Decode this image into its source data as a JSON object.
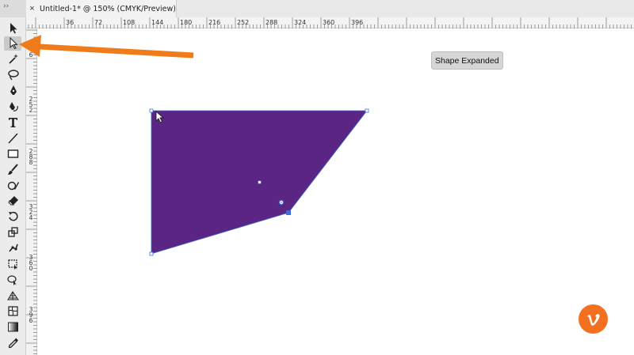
{
  "app": {
    "tab_title": "Untitled-1* @ 150% (CMYK/Preview)",
    "tab_close_glyph": "×",
    "panel_grip_glyph": "››"
  },
  "ruler_top": {
    "labels": [
      "36",
      "72",
      "108",
      "144",
      "180",
      "216",
      "252",
      "288",
      "324",
      "360",
      "396"
    ]
  },
  "ruler_left": {
    "labels": [
      "6",
      "252",
      "288",
      "324",
      "360",
      "396"
    ]
  },
  "tools": [
    {
      "name": "selection-tool-icon",
      "active": false
    },
    {
      "name": "direct-selection-tool-icon",
      "active": true
    },
    {
      "name": "magic-wand-tool-icon",
      "active": false
    },
    {
      "name": "lasso-tool-icon",
      "active": false
    },
    {
      "name": "pen-tool-icon",
      "active": false
    },
    {
      "name": "curvature-tool-icon",
      "active": false
    },
    {
      "name": "type-tool-icon",
      "active": false
    },
    {
      "name": "line-segment-tool-icon",
      "active": false
    },
    {
      "name": "rectangle-tool-icon",
      "active": false
    },
    {
      "name": "paintbrush-tool-icon",
      "active": false
    },
    {
      "name": "shaper-tool-icon",
      "active": false
    },
    {
      "name": "eraser-tool-icon",
      "active": false
    },
    {
      "name": "rotate-tool-icon",
      "active": false
    },
    {
      "name": "scale-tool-icon",
      "active": false
    },
    {
      "name": "puppet-warp-tool-icon",
      "active": false
    },
    {
      "name": "free-transform-tool-icon",
      "active": false
    },
    {
      "name": "shape-builder-tool-icon",
      "active": false
    },
    {
      "name": "perspective-grid-tool-icon",
      "active": false
    },
    {
      "name": "mesh-tool-icon",
      "active": false
    },
    {
      "name": "gradient-tool-icon",
      "active": false
    },
    {
      "name": "eyedropper-tool-icon",
      "active": false
    }
  ],
  "canvas": {
    "tooltip_text": "Shape Expanded",
    "shape_fill": "#5b2683",
    "selection_color": "#3d6fd8"
  },
  "annotation": {
    "arrow_color": "#f07b1a",
    "points_to": "direct-selection-tool-icon"
  },
  "branding": {
    "logo_color": "#f37021",
    "logo_letter": "v"
  }
}
